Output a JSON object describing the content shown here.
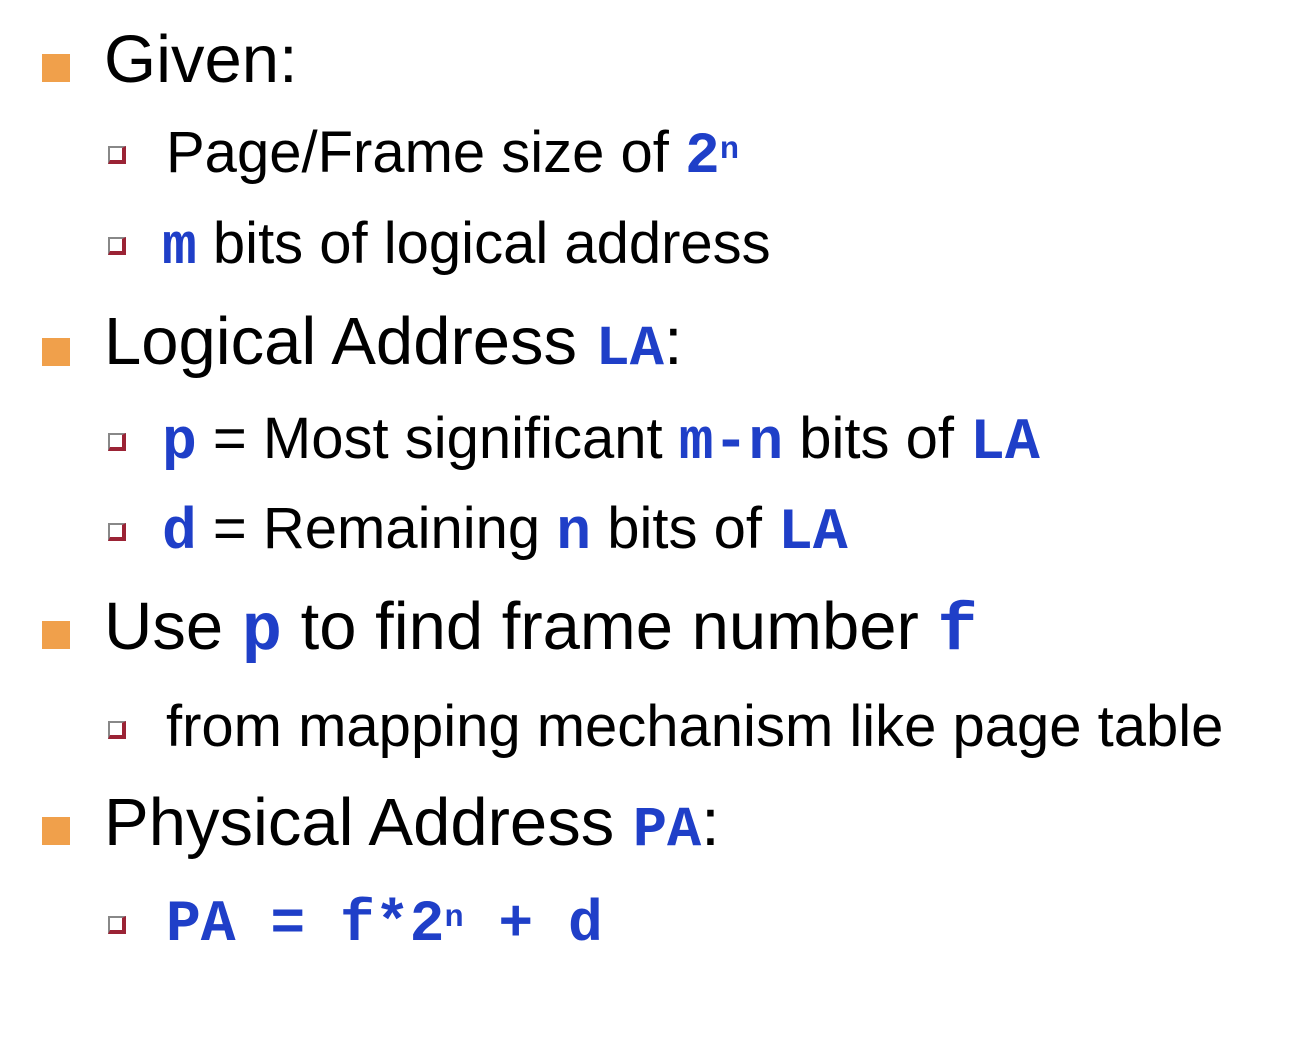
{
  "given": {
    "label": "Given:",
    "page_size_text": "Page/Frame size of ",
    "page_size_base": "2",
    "page_size_exp": "n",
    "m_var": "m",
    "m_text": " bits of logical address"
  },
  "logical": {
    "label": "Logical Address ",
    "la": "LA",
    "colon": ":",
    "p_var": "p",
    "p_eq": " = Most significant ",
    "p_expr": "m-n",
    "p_tail": " bits of ",
    "p_la": "LA",
    "d_var": "d",
    "d_eq": " = Remaining ",
    "d_n": "n",
    "d_tail": " bits of ",
    "d_la": "LA"
  },
  "frame": {
    "use": "Use ",
    "p": "p",
    "to_find": " to find frame number ",
    "f": "f",
    "from": "from mapping mechanism like page table"
  },
  "physical": {
    "label": "Physical Address ",
    "pa": "PA",
    "colon": ":",
    "formula_left": "PA = f*2",
    "formula_exp": "n",
    "formula_right": " + d"
  },
  "colors": {
    "main_bullet": "#F0A04B",
    "sub_bullet": "#9B2335",
    "code": "#1F3FC8"
  }
}
